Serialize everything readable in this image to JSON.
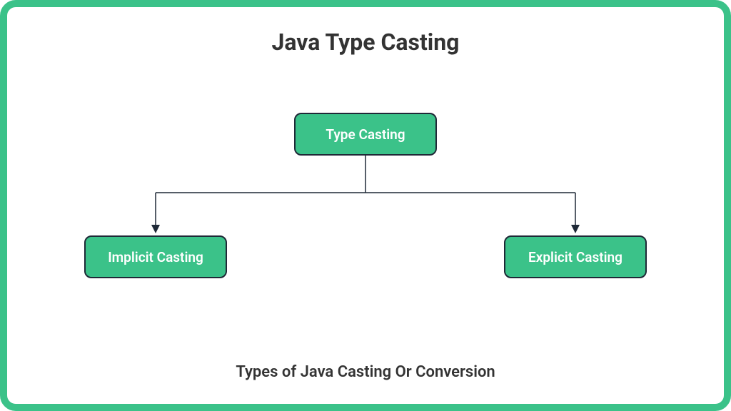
{
  "title": "Java Type Casting",
  "subtitle": "Types of Java Casting Or Conversion",
  "nodes": {
    "root": "Type Casting",
    "left": "Implicit Casting",
    "right": "Explicit Casting"
  },
  "colors": {
    "accent": "#3bc289",
    "text": "#333333",
    "outline": "#1f2937"
  }
}
